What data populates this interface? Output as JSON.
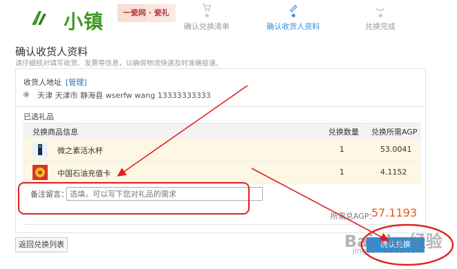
{
  "header": {
    "logo_text": "小镇",
    "banner_text": "一瓷网 · 瓷礼",
    "steps": [
      {
        "label": "确认兑换清单",
        "active": false,
        "icon": "cart-icon"
      },
      {
        "label": "确认收货人资料",
        "active": true,
        "icon": "pencil-icon"
      },
      {
        "label": "兑换完成",
        "active": false,
        "icon": "check-icon"
      }
    ]
  },
  "page": {
    "title": "确认收货人资料",
    "subtitle": "请仔细核对填写收货、发票等信息，以确保物流快递及时准确投递。"
  },
  "address": {
    "label": "收货人地址",
    "manage_label": "[管理]",
    "value": "天津 天津市 静海县 wserfw  wang  13333333333"
  },
  "gifts": {
    "label": "已选礼品",
    "columns": [
      "兑换商品信息",
      "兑换数量",
      "兑换所需AGP"
    ],
    "rows": [
      {
        "name": "微之素活水杯",
        "qty": "1",
        "agp": "53.0041"
      },
      {
        "name": "中国石油充值卡",
        "qty": "1",
        "agp": "4.1152"
      }
    ]
  },
  "remark": {
    "label": "备注留言：",
    "placeholder": "选填，可以写下您对礼品的需求"
  },
  "total": {
    "label": "所需总AGP：",
    "value": "57.1193"
  },
  "actions": {
    "back_label": "返回兑换列表",
    "next_label": "确认兑换"
  },
  "watermark": {
    "text": "Bai du 经验",
    "sub": "jingyan.baidu.com"
  },
  "colors": {
    "accent": "#3b8bd8",
    "brand_green": "#3f9b25",
    "total_orange": "#e15a17",
    "annotation_red": "#e02020"
  }
}
